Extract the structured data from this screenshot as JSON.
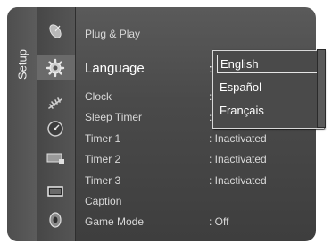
{
  "side_tab": {
    "label": "Setup"
  },
  "icons": [
    "satellite-dish-icon",
    "setup-gear-icon",
    "antenna-icon",
    "clock-dial-icon",
    "input-source-icon",
    "picture-screen-icon",
    "sound-speaker-icon"
  ],
  "menu": {
    "items": [
      {
        "label": "Plug & Play",
        "value": ""
      },
      {
        "label": "Language",
        "value": ":"
      },
      {
        "label": "Clock",
        "value": ":"
      },
      {
        "label": "Sleep Timer",
        "value": ":"
      },
      {
        "label": "Timer 1",
        "value": ": Inactivated"
      },
      {
        "label": "Timer 2",
        "value": ": Inactivated"
      },
      {
        "label": "Timer 3",
        "value": ": Inactivated"
      },
      {
        "label": "Caption",
        "value": ""
      },
      {
        "label": "Game Mode",
        "value": ": Off"
      }
    ]
  },
  "language_dropdown": {
    "options": [
      "English",
      "Español",
      "Français"
    ],
    "selected": "English"
  },
  "colors": {
    "panel": "#4a4a4a",
    "text": "#d9d9d9",
    "highlight": "#ffffff"
  }
}
